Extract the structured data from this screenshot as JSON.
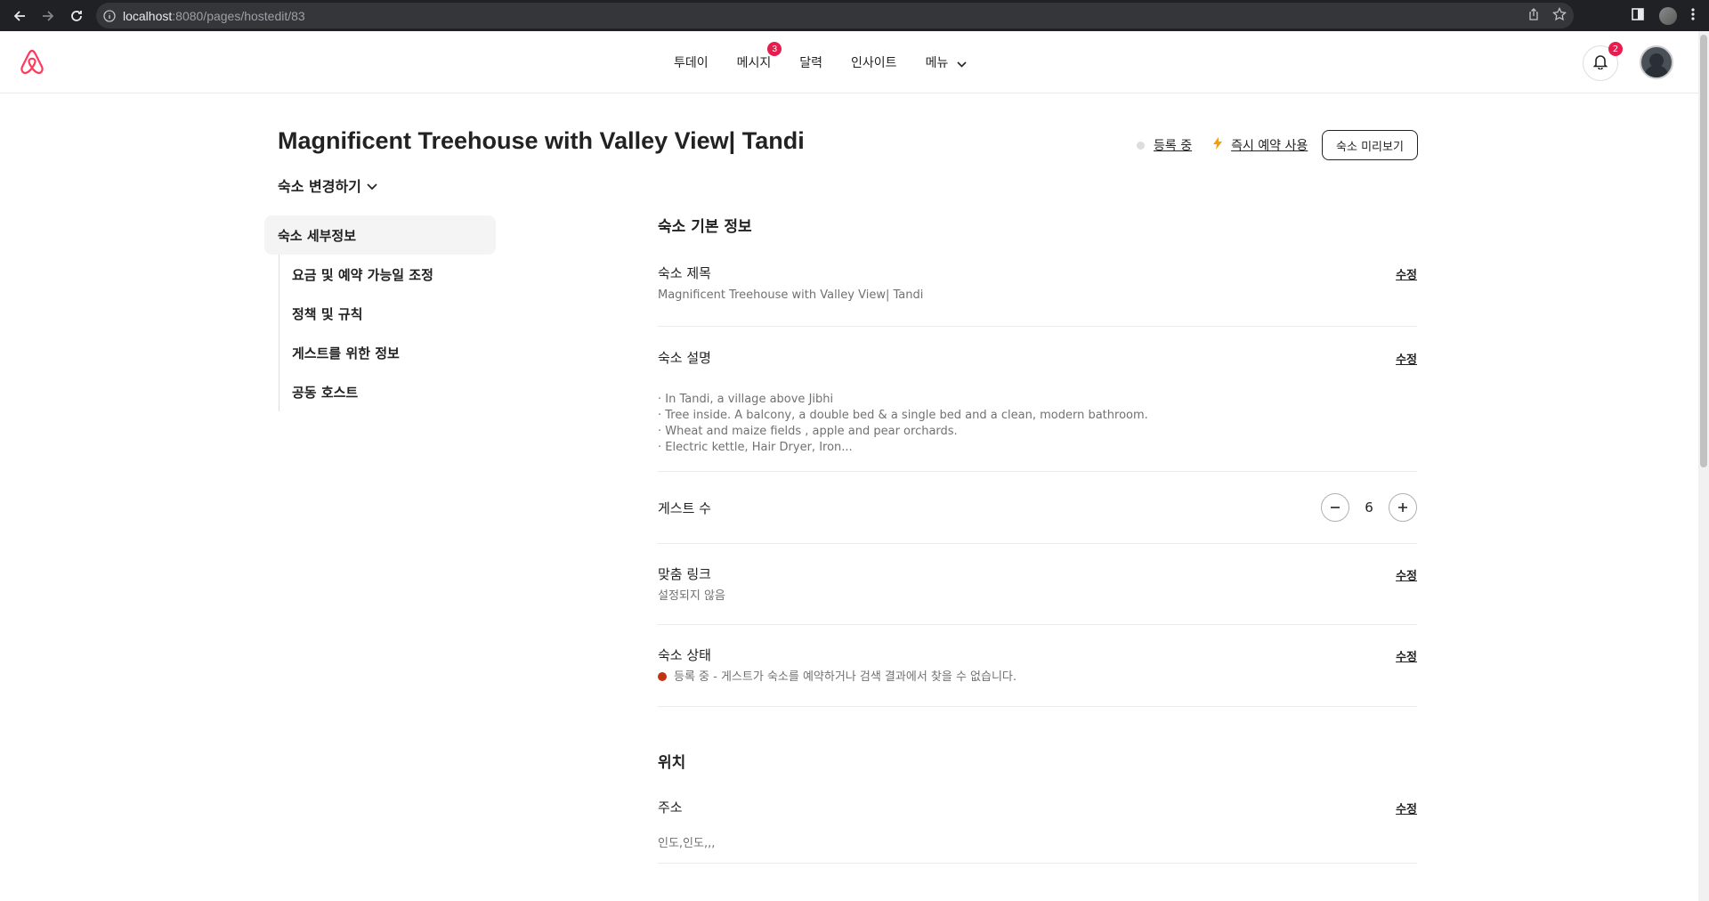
{
  "browser": {
    "url_host": "localhost",
    "url_path": ":8080/pages/hostedit/83"
  },
  "header": {
    "nav": [
      {
        "label": "투데이"
      },
      {
        "label": "메시지",
        "badge": "3"
      },
      {
        "label": "달력"
      },
      {
        "label": "인사이트"
      },
      {
        "label": "메뉴"
      }
    ],
    "notification_badge": "2"
  },
  "page": {
    "title": "Magnificent Treehouse with Valley View| Tandi",
    "switch_listing": "숙소 변경하기",
    "status_label": "등록 중",
    "instant_book_label": "즉시 예약 사용",
    "preview_button": "숙소 미리보기"
  },
  "sidebar": {
    "active": "숙소 세부정보",
    "items": [
      {
        "label": "요금 및 예약 가능일 조정"
      },
      {
        "label": "정책 및 규칙"
      },
      {
        "label": "게스트를 위한 정보"
      },
      {
        "label": "공동 호스트"
      }
    ]
  },
  "basic_info": {
    "section_title": "숙소 기본 정보",
    "edit_label": "수정",
    "title_label": "숙소 제목",
    "title_value": "Magnificent Treehouse with Valley View| Tandi",
    "desc_label": "숙소 설명",
    "desc_lines": [
      "· In Tandi, a village above Jibhi",
      "· Tree inside. A balcony, a double bed & a single bed and a clean, modern bathroom.",
      "· Wheat and maize fields , apple and pear orchards.",
      "· Electric kettle, Hair Dryer, Iron..."
    ],
    "guests_label": "게스트 수",
    "guests_value": "6",
    "link_label": "맞춤 링크",
    "link_value": "설정되지 않음",
    "status_label": "숙소 상태",
    "status_value": "등록 중 - 게스트가 숙소를 예약하거나 검색 결과에서 찾을 수 없습니다."
  },
  "location": {
    "section_title": "위치",
    "address_label": "주소",
    "address_value": "인도,인도,,,"
  },
  "colors": {
    "accent": "#e61e4d",
    "status_red": "#c13515",
    "flash": "#f59e0b"
  }
}
